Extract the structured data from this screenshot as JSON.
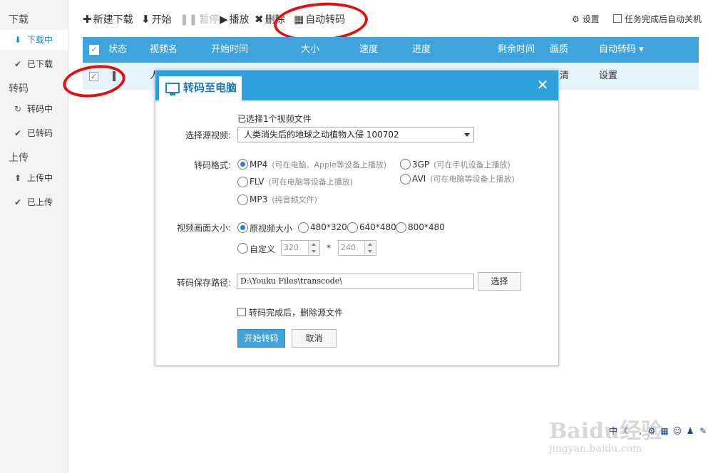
{
  "sidebar": {
    "download_title": "下载",
    "downloading": "下载中",
    "downloaded": "已下载",
    "transcode_title": "转码",
    "transcoding": "转码中",
    "transcoded": "已转码",
    "upload_title": "上传",
    "uploading": "上传中",
    "uploaded": "已上传"
  },
  "toolbar": {
    "new_download": "新建下载",
    "start": "开始",
    "pause": "暂停",
    "play": "播放",
    "delete": "删除",
    "auto_transcode": "自动转码",
    "settings": "设置",
    "shutdown_after": "任务完成后自动关机"
  },
  "table": {
    "headers": [
      "状态",
      "视频名",
      "开始时间",
      "大小",
      "速度",
      "进度",
      "剩余时间",
      "画质",
      "自动转码"
    ],
    "row": {
      "name_partial": "人",
      "quality_partial": "清",
      "auto": "设置"
    }
  },
  "dialog": {
    "title": "转码至电脑",
    "selected_count": "已选择1个视频文件",
    "source_label": "选择源视频:",
    "source_value": "人类消失后的地球之动植物入侵 100702",
    "format_label": "转码格式:",
    "formats": [
      {
        "name": "MP4",
        "hint": "(可在电脑、Apple等设备上播放)",
        "selected": true
      },
      {
        "name": "3GP",
        "hint": "(可在手机设备上播放)",
        "selected": false
      },
      {
        "name": "FLV",
        "hint": "(可在电脑等设备上播放)",
        "selected": false
      },
      {
        "name": "AVI",
        "hint": "(可在电脑等设备上播放)",
        "selected": false
      },
      {
        "name": "MP3",
        "hint": "(纯音频文件)",
        "selected": false
      }
    ],
    "size_label": "视频画面大小:",
    "sizes": [
      "原视频大小",
      "480*320",
      "640*480",
      "800*480"
    ],
    "custom_label": "自定义",
    "custom_width": "320",
    "custom_height": "240",
    "times": "*",
    "path_label": "转码保存路径:",
    "path_value": "D:\\Youku Files\\transcode\\",
    "choose": "选择",
    "delete_source": "转码完成后，删除源文件",
    "start_button": "开始转码",
    "cancel_button": "取消"
  },
  "watermark": {
    "brand": "Baidu经验",
    "url": "jingyan.baidu.com"
  },
  "colors": {
    "accent": "#3fa3dd",
    "annotation": "#e01010"
  }
}
